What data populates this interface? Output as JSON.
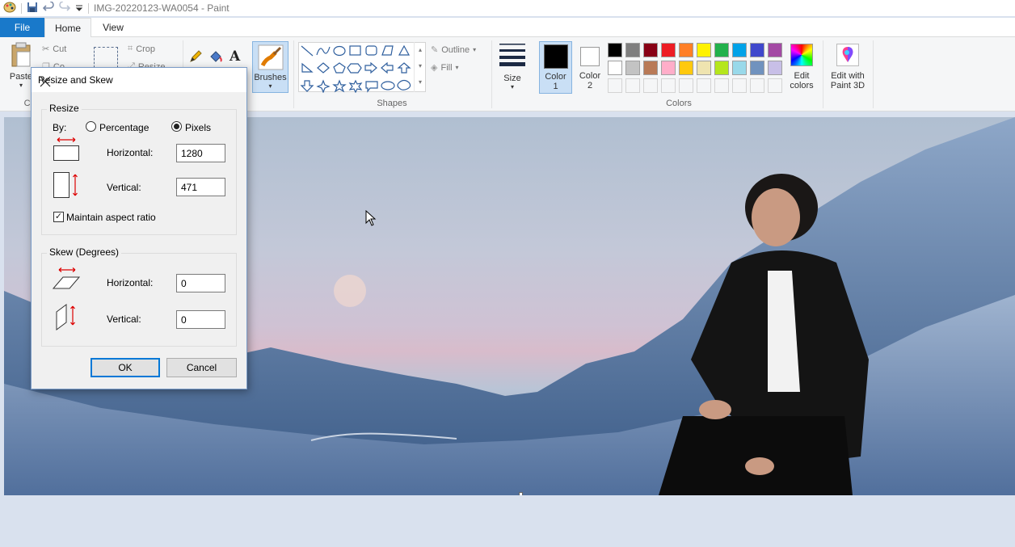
{
  "window": {
    "title": "IMG-20220123-WA0054 - Paint"
  },
  "tabs": {
    "file": "File",
    "home": "Home",
    "view": "View"
  },
  "clipboard": {
    "paste": "Paste",
    "cut": "Cut",
    "copy": "Co",
    "group": "Cli"
  },
  "image_group": {
    "crop": "Crop",
    "resize": "Resize"
  },
  "brushes": {
    "label": "Brushes"
  },
  "shapes": {
    "outline": "Outline",
    "fill": "Fill",
    "group": "Shapes"
  },
  "size": {
    "label": "Size"
  },
  "colors": {
    "color1_line1": "Color",
    "color1_line2": "1",
    "color2_line1": "Color",
    "color2_line2": "2",
    "edit_line1": "Edit",
    "edit_line2": "colors",
    "group": "Colors",
    "row1": [
      "#000000",
      "#7f7f7f",
      "#880015",
      "#ed1c24",
      "#ff7f27",
      "#fff200",
      "#22b14c",
      "#00a2e8",
      "#3f48cc",
      "#a349a4"
    ],
    "row2": [
      "#ffffff",
      "#c3c3c3",
      "#b97a57",
      "#ffaec9",
      "#ffc90e",
      "#efe4b0",
      "#b5e61d",
      "#99d9ea",
      "#7092be",
      "#c8bfe7"
    ]
  },
  "paint3d": {
    "line1": "Edit with",
    "line2": "Paint 3D"
  },
  "dialog": {
    "title": "Resize and Skew",
    "resize_legend": "Resize",
    "by_label": "By:",
    "percentage": "Percentage",
    "pixels": "Pixels",
    "horizontal": "Horizontal:",
    "vertical": "Vertical:",
    "resize_h_value": "1280",
    "resize_v_value": "471",
    "maintain": "Maintain aspect ratio",
    "skew_legend": "Skew (Degrees)",
    "skew_h_value": "0",
    "skew_v_value": "0",
    "ok": "OK",
    "cancel": "Cancel"
  }
}
